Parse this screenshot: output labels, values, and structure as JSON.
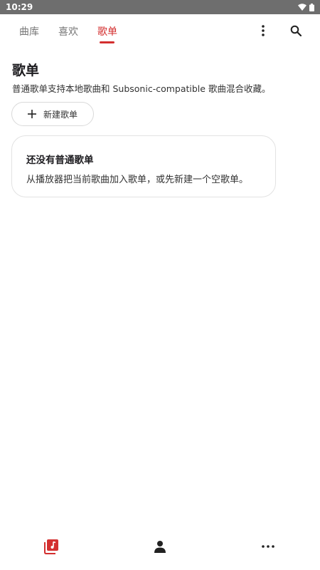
{
  "status_bar": {
    "time": "10:29"
  },
  "tabs": [
    {
      "label": "曲库",
      "active": false
    },
    {
      "label": "喜欢",
      "active": false
    },
    {
      "label": "歌单",
      "active": true
    }
  ],
  "top_actions": {
    "more_icon": "more-vert-icon",
    "search_icon": "search-icon"
  },
  "page": {
    "title": "歌单",
    "description": "普通歌单支持本地歌曲和 Subsonic-compatible 歌曲混合收藏。"
  },
  "new_playlist_button": {
    "label": "新建歌单",
    "icon": "plus-icon"
  },
  "empty_state": {
    "title": "还没有普通歌单",
    "description": "从播放器把当前歌曲加入歌单，或先新建一个空歌单。"
  },
  "bottom_nav": [
    {
      "icon": "music-library-icon",
      "active": true
    },
    {
      "icon": "person-icon",
      "active": false
    },
    {
      "icon": "more-horiz-icon",
      "active": false
    }
  ],
  "colors": {
    "accent": "#d32f2f",
    "status_bar": "#6e6e6e"
  }
}
